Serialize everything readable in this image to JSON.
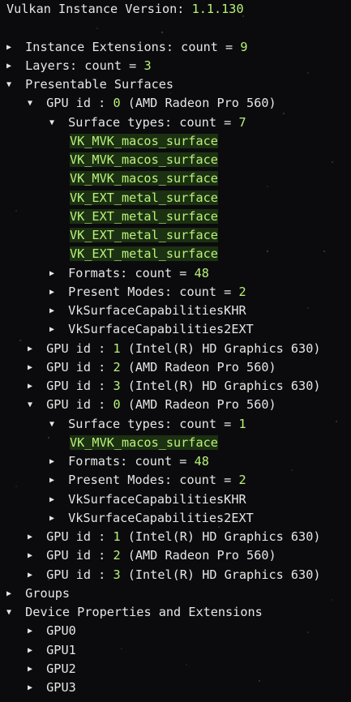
{
  "header": {
    "label": "Vulkan Instance Version: ",
    "value": "1.1.130"
  },
  "instance_extensions": {
    "label": "Instance Extensions: count = ",
    "count": "9"
  },
  "layers": {
    "label": "Layers: count = ",
    "count": "3"
  },
  "presentable_surfaces": {
    "label": "Presentable Surfaces",
    "gpus": [
      {
        "pre": "GPU id : ",
        "id": "0",
        "name": " (AMD Radeon Pro 560)",
        "surface_types": {
          "label": "Surface types: count = ",
          "count": "7",
          "items": [
            "VK_MVK_macos_surface",
            "VK_MVK_macos_surface",
            "VK_MVK_macos_surface",
            "VK_EXT_metal_surface",
            "VK_EXT_metal_surface",
            "VK_EXT_metal_surface",
            "VK_EXT_metal_surface"
          ]
        },
        "formats": {
          "label": "Formats: count = ",
          "count": "48"
        },
        "present_modes": {
          "label": "Present Modes: count = ",
          "count": "2"
        },
        "caps_khr": "VkSurfaceCapabilitiesKHR",
        "caps2_ext": "VkSurfaceCapabilities2EXT"
      },
      {
        "pre": "GPU id : ",
        "id": "1",
        "name": " (Intel(R) HD Graphics 630)"
      },
      {
        "pre": "GPU id : ",
        "id": "2",
        "name": " (AMD Radeon Pro 560)"
      },
      {
        "pre": "GPU id : ",
        "id": "3",
        "name": " (Intel(R) HD Graphics 630)"
      },
      {
        "pre": "GPU id : ",
        "id": "0",
        "name": " (AMD Radeon Pro 560)",
        "surface_types": {
          "label": "Surface types: count = ",
          "count": "1",
          "items": [
            "VK_MVK_macos_surface"
          ]
        },
        "formats": {
          "label": "Formats: count = ",
          "count": "48"
        },
        "present_modes": {
          "label": "Present Modes: count = ",
          "count": "2"
        },
        "caps_khr": "VkSurfaceCapabilitiesKHR",
        "caps2_ext": "VkSurfaceCapabilities2EXT"
      },
      {
        "pre": "GPU id : ",
        "id": "1",
        "name": " (Intel(R) HD Graphics 630)"
      },
      {
        "pre": "GPU id : ",
        "id": "2",
        "name": " (AMD Radeon Pro 560)"
      },
      {
        "pre": "GPU id : ",
        "id": "3",
        "name": " (Intel(R) HD Graphics 630)"
      }
    ]
  },
  "groups": {
    "label": "Groups"
  },
  "device_properties": {
    "label": "Device Properties and Extensions",
    "gpus": [
      "GPU0",
      "GPU1",
      "GPU2",
      "GPU3"
    ]
  },
  "icons": {
    "collapsed": "triangle-right-icon",
    "expanded": "triangle-down-icon"
  },
  "colors": {
    "background": "#0b0b0d",
    "text": "#e6e6e6",
    "value": "#b8f27a",
    "highlight_bg": "#1c3012"
  }
}
